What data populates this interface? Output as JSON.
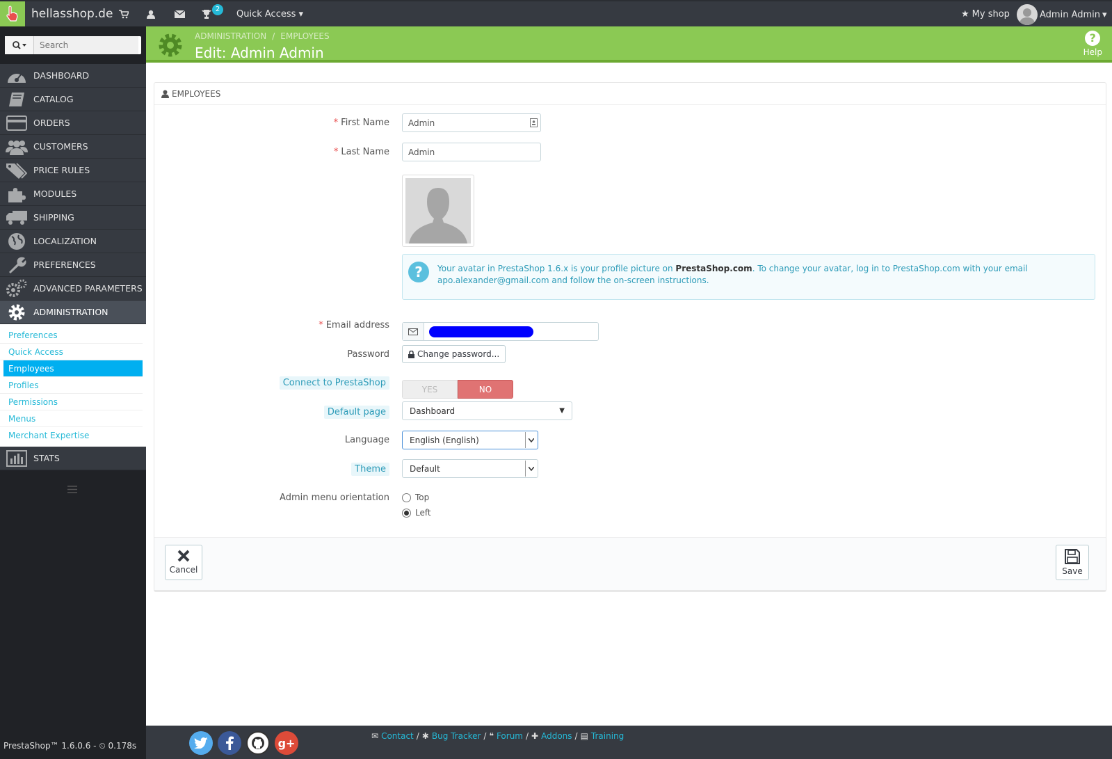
{
  "topbar": {
    "shop_name": "hellasshop.de",
    "badge_count": "2",
    "quick_access": "Quick Access",
    "my_shop": "My shop",
    "user_name": "Admin Admin"
  },
  "sidebar": {
    "search_placeholder": "Search",
    "items": [
      {
        "label": "DASHBOARD",
        "icon": "dashboard-icon"
      },
      {
        "label": "CATALOG",
        "icon": "book-icon"
      },
      {
        "label": "ORDERS",
        "icon": "credit-card-icon"
      },
      {
        "label": "CUSTOMERS",
        "icon": "users-icon"
      },
      {
        "label": "PRICE RULES",
        "icon": "tags-icon"
      },
      {
        "label": "MODULES",
        "icon": "puzzle-icon"
      },
      {
        "label": "SHIPPING",
        "icon": "truck-icon"
      },
      {
        "label": "LOCALIZATION",
        "icon": "globe-icon"
      },
      {
        "label": "PREFERENCES",
        "icon": "wrench-icon"
      },
      {
        "label": "ADVANCED PARAMETERS",
        "icon": "cogs-icon"
      },
      {
        "label": "ADMINISTRATION",
        "icon": "gear-icon"
      }
    ],
    "submenu": [
      "Preferences",
      "Quick Access",
      "Employees",
      "Profiles",
      "Permissions",
      "Menus",
      "Merchant Expertise"
    ],
    "stats": "STATS"
  },
  "header": {
    "crumb1": "ADMINISTRATION",
    "crumb_sep": "/",
    "crumb2": "EMPLOYEES",
    "title": "Edit: Admin Admin",
    "help": "Help"
  },
  "form": {
    "panel_title": "EMPLOYEES",
    "required_mark": "*",
    "first_name_label": "First Name",
    "first_name_value": "Admin",
    "last_name_label": "Last Name",
    "last_name_value": "Admin",
    "info_pre": "Your avatar in PrestaShop 1.6.x is your profile picture on ",
    "info_brand": "PrestaShop.com",
    "info_post": ". To change your avatar, log in to PrestaShop.com with your email",
    "info_line2": "apo.alexander@gmail.com and follow the on-screen instructions.",
    "email_label": "Email address",
    "password_label": "Password",
    "change_password": "Change password...",
    "connect_label": "Connect to PrestaShop",
    "yes": "YES",
    "no": "NO",
    "default_page_label": "Default page",
    "default_page_value": "Dashboard",
    "language_label": "Language",
    "language_value": "English (English)",
    "theme_label": "Theme",
    "theme_value": "Default",
    "orientation_label": "Admin menu orientation",
    "orientation_top": "Top",
    "orientation_left": "Left",
    "cancel": "Cancel",
    "save": "Save"
  },
  "footer": {
    "version": "PrestaShop™ 1.6.0.6 - ",
    "time": "0.178s",
    "links": [
      "Contact",
      "Bug Tracker",
      "Forum",
      "Addons",
      "Training"
    ],
    "link_sep": "/"
  },
  "colors": {
    "header_green": "#8bc954",
    "sidebar_dark": "#363a41",
    "accent_blue": "#25b9d7",
    "no_red": "#e07373"
  }
}
